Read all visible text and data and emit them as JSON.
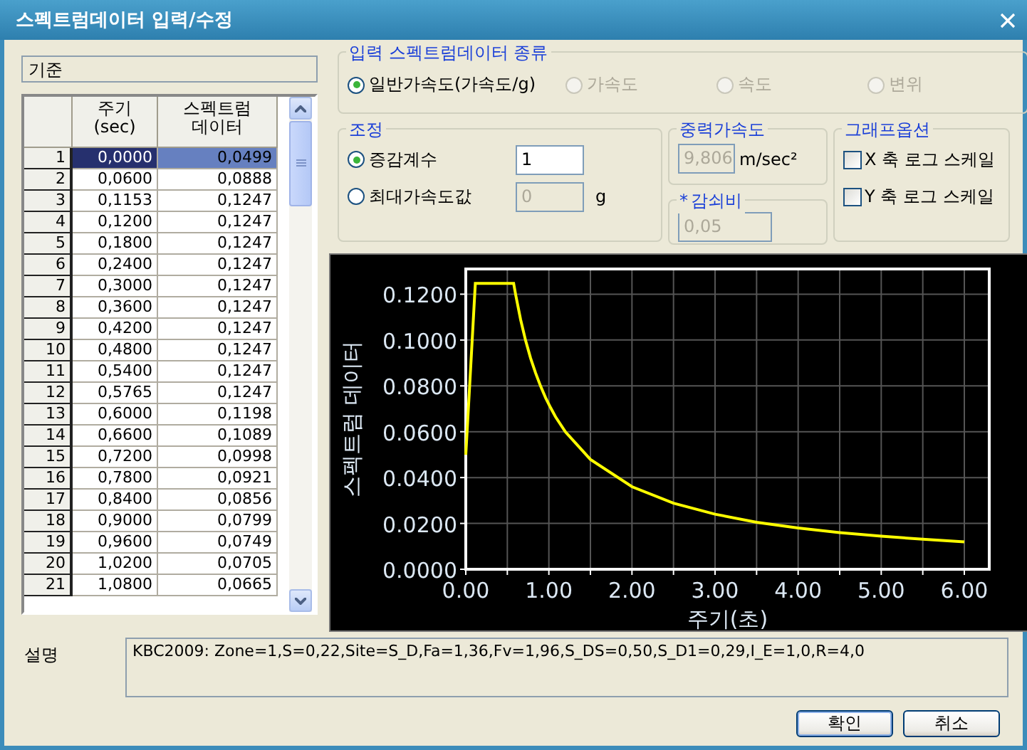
{
  "window": {
    "title": "스펙트럼데이터 입력/수정"
  },
  "standard_box": {
    "text": "기준"
  },
  "table": {
    "columns": [
      "주기 (sec)",
      "스펙트럼 데이터"
    ],
    "rows": [
      {
        "index": "1",
        "period": "0,0000",
        "value": "0,0499",
        "selected": true
      },
      {
        "index": "2",
        "period": "0,0600",
        "value": "0,0888",
        "selected": false
      },
      {
        "index": "3",
        "period": "0,1153",
        "value": "0,1247",
        "selected": false
      },
      {
        "index": "4",
        "period": "0,1200",
        "value": "0,1247",
        "selected": false
      },
      {
        "index": "5",
        "period": "0,1800",
        "value": "0,1247",
        "selected": false
      },
      {
        "index": "6",
        "period": "0,2400",
        "value": "0,1247",
        "selected": false
      },
      {
        "index": "7",
        "period": "0,3000",
        "value": "0,1247",
        "selected": false
      },
      {
        "index": "8",
        "period": "0,3600",
        "value": "0,1247",
        "selected": false
      },
      {
        "index": "9",
        "period": "0,4200",
        "value": "0,1247",
        "selected": false
      },
      {
        "index": "10",
        "period": "0,4800",
        "value": "0,1247",
        "selected": false
      },
      {
        "index": "11",
        "period": "0,5400",
        "value": "0,1247",
        "selected": false
      },
      {
        "index": "12",
        "period": "0,5765",
        "value": "0,1247",
        "selected": false
      },
      {
        "index": "13",
        "period": "0,6000",
        "value": "0,1198",
        "selected": false
      },
      {
        "index": "14",
        "period": "0,6600",
        "value": "0,1089",
        "selected": false
      },
      {
        "index": "15",
        "period": "0,7200",
        "value": "0,0998",
        "selected": false
      },
      {
        "index": "16",
        "period": "0,7800",
        "value": "0,0921",
        "selected": false
      },
      {
        "index": "17",
        "period": "0,8400",
        "value": "0,0856",
        "selected": false
      },
      {
        "index": "18",
        "period": "0,9000",
        "value": "0,0799",
        "selected": false
      },
      {
        "index": "19",
        "period": "0,9600",
        "value": "0,0749",
        "selected": false
      },
      {
        "index": "20",
        "period": "1,0200",
        "value": "0,0705",
        "selected": false
      },
      {
        "index": "21",
        "period": "1,0800",
        "value": "0,0665",
        "selected": false
      }
    ]
  },
  "spectrum_type": {
    "legend": "입력 스펙트럼데이터 종류",
    "options": [
      {
        "label": "일반가속도(가속도/g)",
        "selected": true,
        "disabled": false
      },
      {
        "label": "가속도",
        "selected": false,
        "disabled": true
      },
      {
        "label": "속도",
        "selected": false,
        "disabled": true
      },
      {
        "label": "변위",
        "selected": false,
        "disabled": true
      }
    ]
  },
  "adjustment": {
    "legend": "조정",
    "options": [
      {
        "label": "증감계수",
        "selected": true,
        "value": "1",
        "disabled": false
      },
      {
        "label": "최대가속도값",
        "selected": false,
        "value": "0",
        "disabled": true,
        "unit": "g"
      }
    ]
  },
  "gravity": {
    "legend": "중력가속도",
    "value": "9,806",
    "disabled": true,
    "unit": "m/sec²"
  },
  "damping": {
    "marker": "*",
    "legend": "감쇠비",
    "value": "0,05",
    "disabled": true
  },
  "graph_options": {
    "legend": "그래프옵션",
    "options": [
      {
        "label": "X 축 로그 스케일",
        "checked": false
      },
      {
        "label": "Y 축 로그 스케일",
        "checked": false
      }
    ]
  },
  "chart": {
    "chart_data": {
      "type": "line",
      "xlabel": "주기(초)",
      "ylabel": "스펙트럼 데이터",
      "xlim": [
        0,
        6.3
      ],
      "ylim": [
        0,
        0.131
      ],
      "xticks": [
        {
          "value": 0,
          "label": "0.00"
        },
        {
          "value": 1,
          "label": "1.00"
        },
        {
          "value": 2,
          "label": "2.00"
        },
        {
          "value": 3,
          "label": "3.00"
        },
        {
          "value": 4,
          "label": "4.00"
        },
        {
          "value": 5,
          "label": "5.00"
        },
        {
          "value": 6,
          "label": "6.00"
        }
      ],
      "yticks": [
        {
          "value": 0,
          "label": "0.0000"
        },
        {
          "value": 0.02,
          "label": "0.0200"
        },
        {
          "value": 0.04,
          "label": "0.0400"
        },
        {
          "value": 0.06,
          "label": "0.0600"
        },
        {
          "value": 0.08,
          "label": "0.0800"
        },
        {
          "value": 0.1,
          "label": "0.1000"
        },
        {
          "value": 0.12,
          "label": "0.1200"
        }
      ],
      "x": [
        0,
        0.06,
        0.1153,
        0.12,
        0.18,
        0.24,
        0.3,
        0.36,
        0.42,
        0.48,
        0.54,
        0.5765,
        0.6,
        0.66,
        0.72,
        0.78,
        0.84,
        0.9,
        0.96,
        1.02,
        1.08,
        1.2,
        1.5,
        2,
        2.5,
        3,
        3.5,
        4,
        4.5,
        5,
        5.5,
        6
      ],
      "grid": true,
      "series": [
        {
          "color": "#ffff00",
          "values": [
            0.0499,
            0.0888,
            0.1247,
            0.1247,
            0.1247,
            0.1247,
            0.1247,
            0.1247,
            0.1247,
            0.1247,
            0.1247,
            0.1247,
            0.1198,
            0.1089,
            0.0998,
            0.0921,
            0.0856,
            0.0799,
            0.0749,
            0.0705,
            0.0665,
            0.0599,
            0.0479,
            0.036,
            0.0288,
            0.024,
            0.0205,
            0.018,
            0.016,
            0.0144,
            0.0131,
            0.012
          ]
        }
      ]
    }
  },
  "description": {
    "label": "설명",
    "value": "KBC2009: Zone=1,S=0,22,Site=S_D,Fa=1,36,Fv=1,96,S_DS=0,50,S_D1=0,29,I_E=1,0,R=4,0"
  },
  "buttons": [
    {
      "label": "확인",
      "default": true
    },
    {
      "label": "취소",
      "default": false
    }
  ]
}
